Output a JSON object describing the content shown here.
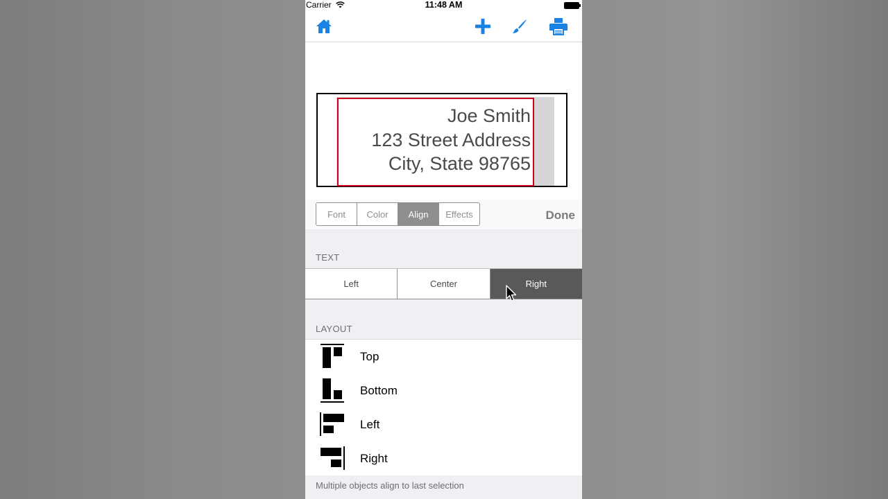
{
  "status_bar": {
    "carrier": "Carrier",
    "time": "11:48 AM"
  },
  "toolbar": {
    "home_icon": "home-icon",
    "add_icon": "plus-icon",
    "brush_icon": "brush-icon",
    "print_icon": "printer-icon",
    "accent_color": "#1a82e2"
  },
  "label": {
    "lines": [
      "Joe Smith",
      "123 Street Address",
      "City, State 98765"
    ],
    "border_color": "#d0021b"
  },
  "editor": {
    "tabs": [
      {
        "label": "Font",
        "active": false
      },
      {
        "label": "Color",
        "active": false
      },
      {
        "label": "Align",
        "active": true
      },
      {
        "label": "Effects",
        "active": false
      }
    ],
    "done_label": "Done"
  },
  "text_section": {
    "header": "TEXT",
    "options": [
      {
        "label": "Left",
        "active": false
      },
      {
        "label": "Center",
        "active": false
      },
      {
        "label": "Right",
        "active": true
      }
    ]
  },
  "layout_section": {
    "header": "LAYOUT",
    "items": [
      {
        "label": "Top",
        "icon": "align-top-icon"
      },
      {
        "label": "Bottom",
        "icon": "align-bottom-icon"
      },
      {
        "label": "Left",
        "icon": "align-left-icon"
      },
      {
        "label": "Right",
        "icon": "align-right-icon"
      }
    ]
  },
  "footer_note": "Multiple objects align to last selection"
}
